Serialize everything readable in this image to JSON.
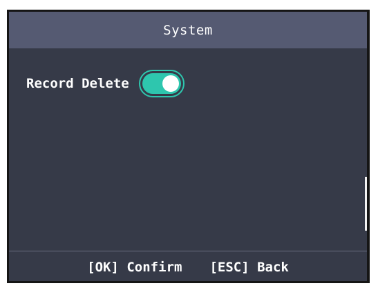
{
  "header": {
    "title": "System"
  },
  "settings": [
    {
      "label": "Record Delete",
      "enabled": true
    }
  ],
  "footer": {
    "confirm_label": "[OK] Confirm",
    "back_label": "[ESC] Back"
  },
  "colors": {
    "header_bg": "#555a72",
    "screen_bg": "#363a48",
    "toggle_on": "#2ec6ae"
  }
}
